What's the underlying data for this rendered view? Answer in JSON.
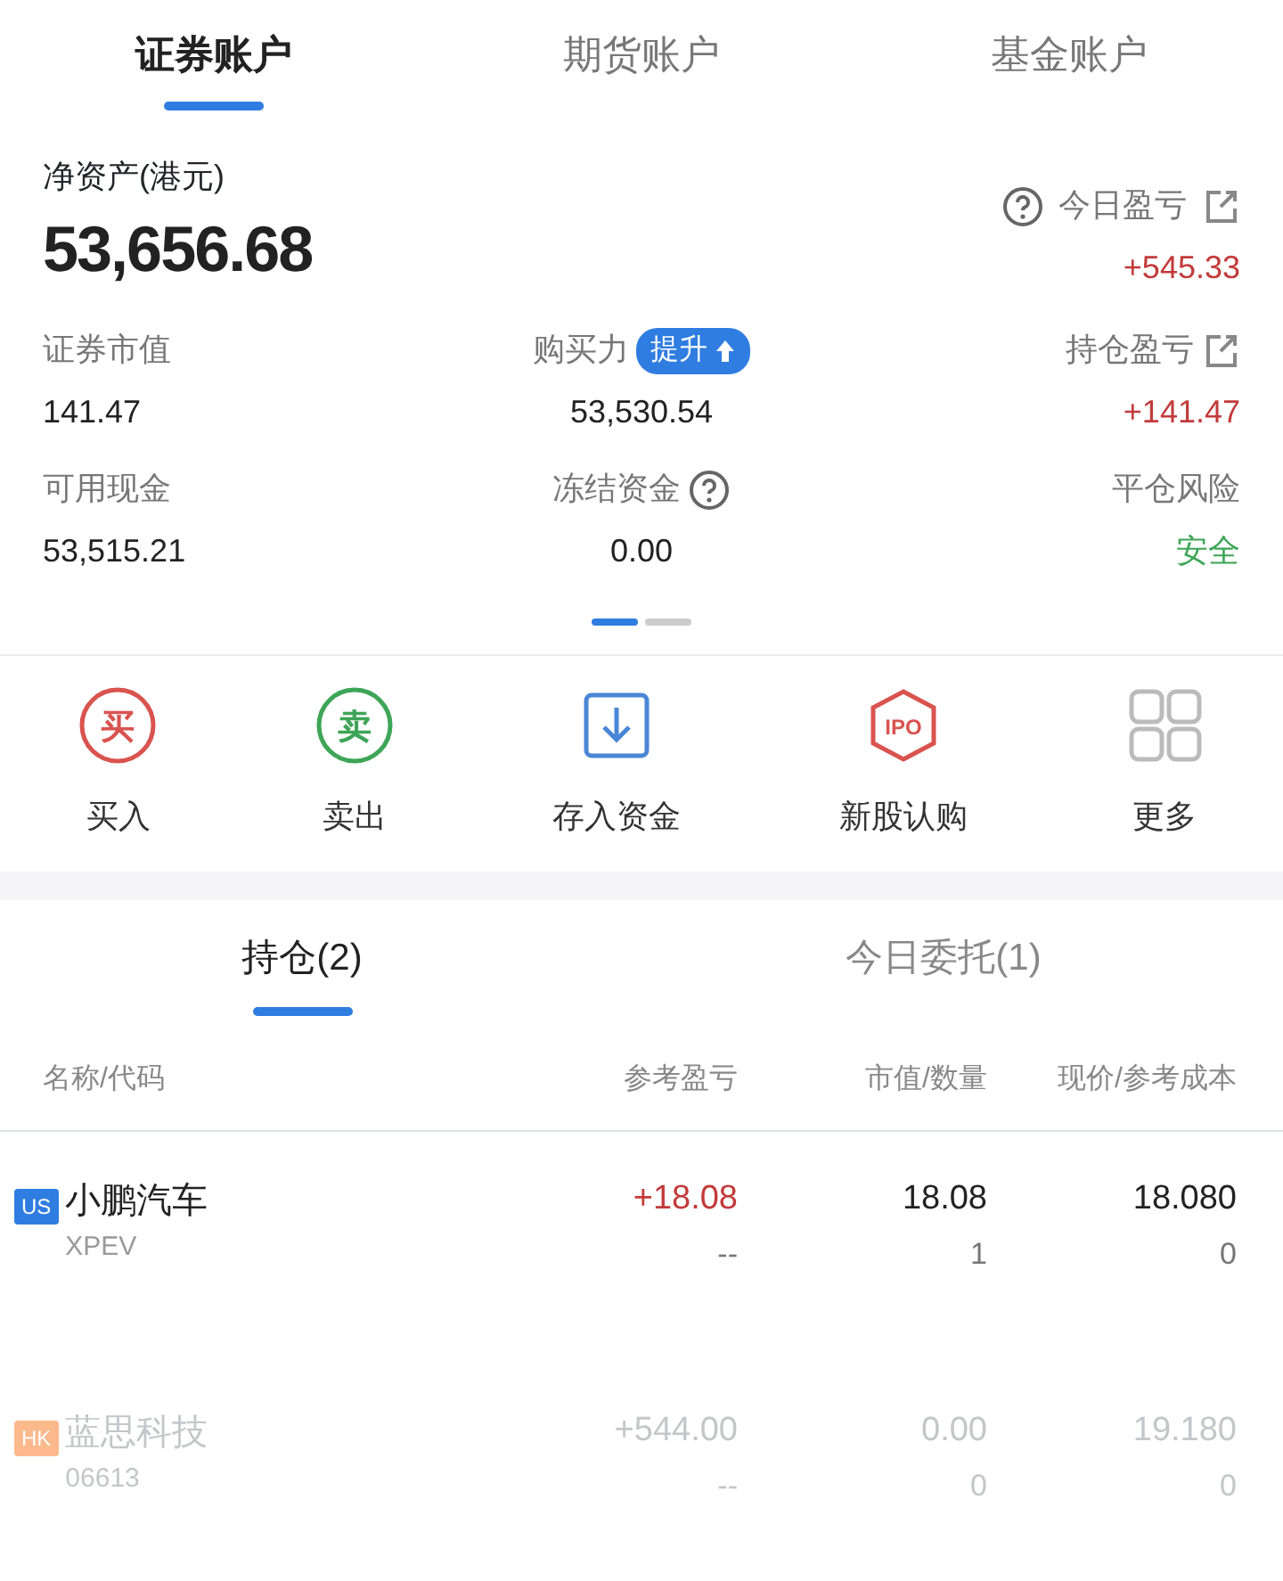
{
  "account_tabs": [
    {
      "label": "证券账户",
      "selected": true
    },
    {
      "label": "期货账户",
      "selected": false
    },
    {
      "label": "基金账户",
      "selected": false
    }
  ],
  "net_assets": {
    "label": "净资产(港元)",
    "value": "53,656.68"
  },
  "today_pnl": {
    "label": "今日盈亏",
    "value": "+545.33",
    "color": "#c33a3a"
  },
  "metrics": [
    {
      "label": "证券市值",
      "value": "141.47",
      "color": "#222222"
    },
    {
      "label": "购买力",
      "badge": "提升",
      "value": "53,530.54",
      "color": "#222222"
    },
    {
      "label": "持仓盈亏",
      "share": true,
      "value": "+141.47",
      "color": "#c33a3a"
    },
    {
      "label": "可用现金",
      "value": "53,515.21",
      "color": "#222222"
    },
    {
      "label": "冻结资金",
      "help": true,
      "value": "0.00",
      "color": "#222222"
    },
    {
      "label": "平仓风险",
      "value": "安全",
      "color": "#3ea557"
    }
  ],
  "pager": [
    {
      "selected": true
    },
    {
      "selected": false
    }
  ],
  "actions": [
    {
      "kind": "buy",
      "icon_text": "买",
      "label": "买入"
    },
    {
      "kind": "sell",
      "icon_text": "卖",
      "label": "卖出"
    },
    {
      "kind": "deposit",
      "label": "存入资金"
    },
    {
      "kind": "ipo",
      "icon_text": "IPO",
      "label": "新股认购"
    },
    {
      "kind": "more",
      "label": "更多"
    }
  ],
  "holding_tabs": [
    {
      "label": "持仓(2)",
      "selected": true
    },
    {
      "label": "今日委托(1)",
      "selected": false
    }
  ],
  "columns": [
    "名称/代码",
    "参考盈亏",
    "市值/数量",
    "现价/参考成本"
  ],
  "rows": [
    {
      "market": "US",
      "color": "#2f7de1",
      "name": "小鹏汽车",
      "code": "XPEV",
      "pnl": "+18.08",
      "pnl_ratio": "--",
      "value": "18.08",
      "quantity": "1",
      "price": "18.080",
      "cost": "0",
      "dimmed": false
    },
    {
      "market": "HK",
      "color": "#fbb98c",
      "name": "蓝思科技",
      "code": "06613",
      "pnl": "+544.00",
      "pnl_ratio": "--",
      "value": "0.00",
      "quantity": "0",
      "price": "19.180",
      "cost": "0",
      "dimmed": true
    }
  ]
}
